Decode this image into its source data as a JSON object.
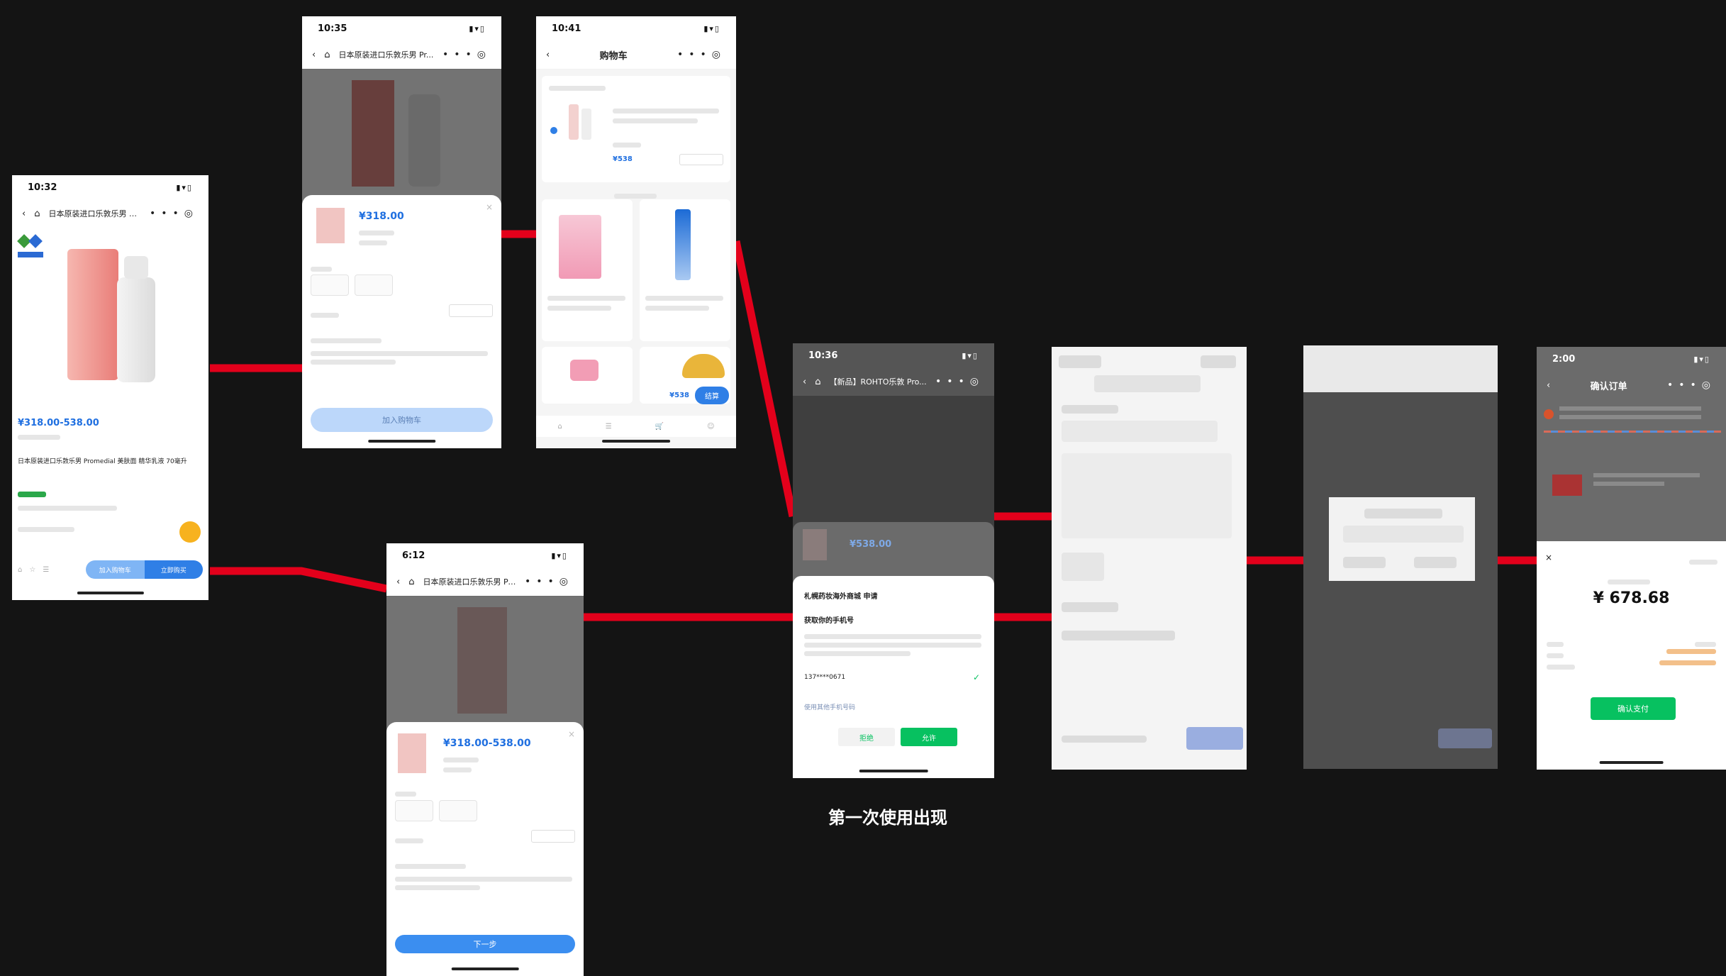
{
  "caption": "第一次使用出现",
  "colors": {
    "background": "#141414",
    "connector": "#e3001b",
    "price_blue": "#1f6fe0",
    "pay_green": "#07c160"
  },
  "screens": {
    "s1": {
      "time": "10:32",
      "nav_title": "日本原装进口乐敦乐男 Pr...",
      "price": "¥318.00-538.00",
      "product_name": "日本原装进口乐敦乐男 Promedial 美肤面 精华乳液 70毫升",
      "buttons": [
        "加入购物车",
        "立即购买"
      ]
    },
    "s2": {
      "time": "10:35",
      "nav_title": "日本原装进口乐敦乐男 Pr...",
      "price": "¥318.00",
      "button": "加入购物车"
    },
    "s3": {
      "time": "10:41",
      "nav_title": "购物车",
      "cart_price": "¥538",
      "checkout_price": "¥538",
      "checkout_button": "结算"
    },
    "s4": {
      "time": "6:12",
      "nav_title": "日本原装进口乐敦乐男 Pr...",
      "price": "¥318.00-538.00",
      "button": "下一步"
    },
    "s5": {
      "time": "10:36",
      "nav_title": "【新品】ROHTO乐敦 Pro...",
      "price": "¥538.00",
      "sheet_title": "札幌药妆海外商城 申请",
      "sheet_sub": "获取你的手机号",
      "phone_number": "137****0671",
      "other_link": "使用其他手机号码",
      "reject": "拒绝",
      "allow": "允许"
    },
    "s8": {
      "time": "2:00",
      "nav_title": "确认订单",
      "amount": "¥ 678.68",
      "pay_button": "确认支付"
    }
  }
}
